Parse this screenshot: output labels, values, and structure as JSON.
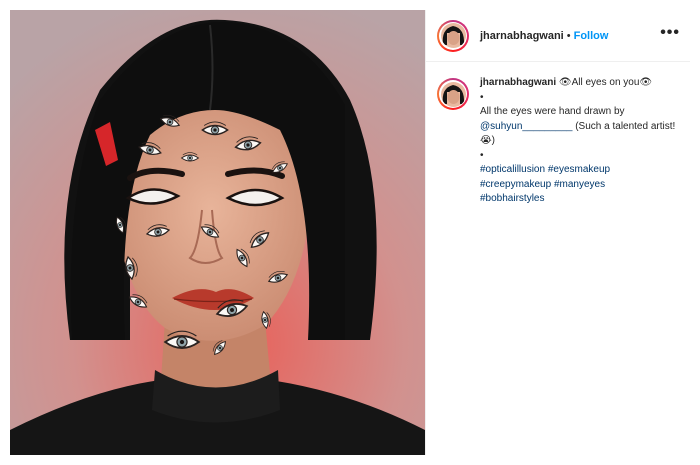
{
  "post": {
    "username": "jharnabhagwani",
    "dot": "•",
    "follow_label": "Follow",
    "more_icon": "•••",
    "caption": {
      "username": "jharnabhagwani",
      "title": "👁All eyes on you👁",
      "bullet1": "•",
      "line1": "All the eyes were hand drawn by",
      "mention": "@suhyun_________",
      "line2": " (Such a talented artist! 😭)",
      "bullet2": "•",
      "hashtags": [
        "#opticalillusion",
        "#eyesmakeup",
        "#creepymakeup",
        "#manyeyes",
        "#bobhairstyles"
      ]
    }
  },
  "colors": {
    "accent": "#0095f6",
    "link": "#00376b",
    "photo_background": "#c98a86"
  }
}
